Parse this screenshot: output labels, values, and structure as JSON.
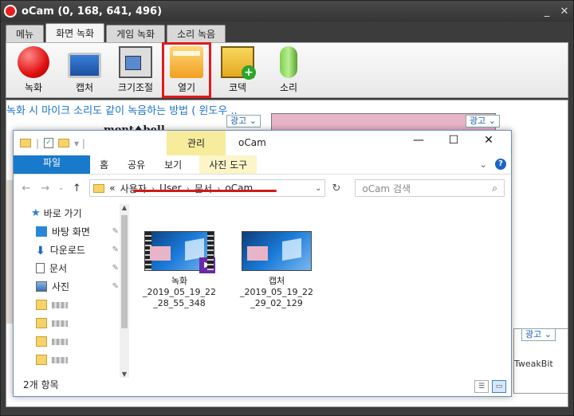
{
  "ocam": {
    "title": "oCam (0, 168, 641, 496)",
    "tabs": [
      "메뉴",
      "화면 녹화",
      "게임 녹화",
      "소리 녹음"
    ],
    "active_tab": "화면 녹화",
    "tools": [
      {
        "label": "녹화",
        "icon": "record-icon"
      },
      {
        "label": "캡처",
        "icon": "monitor-icon"
      },
      {
        "label": "크기조절",
        "icon": "resize-icon"
      },
      {
        "label": "열기",
        "icon": "folder-icon"
      },
      {
        "label": "코덱",
        "icon": "codec-icon"
      },
      {
        "label": "소리",
        "icon": "microphone-icon"
      }
    ],
    "window_buttons": [
      "_",
      "✕"
    ]
  },
  "web": {
    "title": "녹화 시 마이크 소리도 같이 녹음하는 방법 ( 윈도우 ..",
    "ad_label": "광고",
    "brand": "mont♠bell",
    "side_text": "TweakBit"
  },
  "explorer": {
    "window_title": "oCam",
    "manage_tab": "관리",
    "ribbon_tabs": [
      "파일",
      "홈",
      "공유",
      "보기",
      "사진 도구"
    ],
    "address": {
      "prefix": "«",
      "crumbs": [
        "사용자",
        "User",
        "문서",
        "oCam"
      ]
    },
    "search_placeholder": "oCam 검색",
    "nav": [
      {
        "label": "바로 가기",
        "icon": "star-icon",
        "pinned": false
      },
      {
        "label": "바탕 화면",
        "icon": "desktop-icon",
        "pinned": true
      },
      {
        "label": "다운로드",
        "icon": "download-icon",
        "pinned": true
      },
      {
        "label": "문서",
        "icon": "document-icon",
        "pinned": true
      },
      {
        "label": "사진",
        "icon": "pictures-icon",
        "pinned": true
      }
    ],
    "files": [
      {
        "name_line1": "녹화",
        "name_line2": "_2019_05_19_22",
        "name_line3": "_28_55_348",
        "type": "video"
      },
      {
        "name_line1": "캡처",
        "name_line2": "_2019_05_19_22",
        "name_line3": "_29_02_129",
        "type": "image"
      }
    ],
    "status": "2개 항목"
  }
}
